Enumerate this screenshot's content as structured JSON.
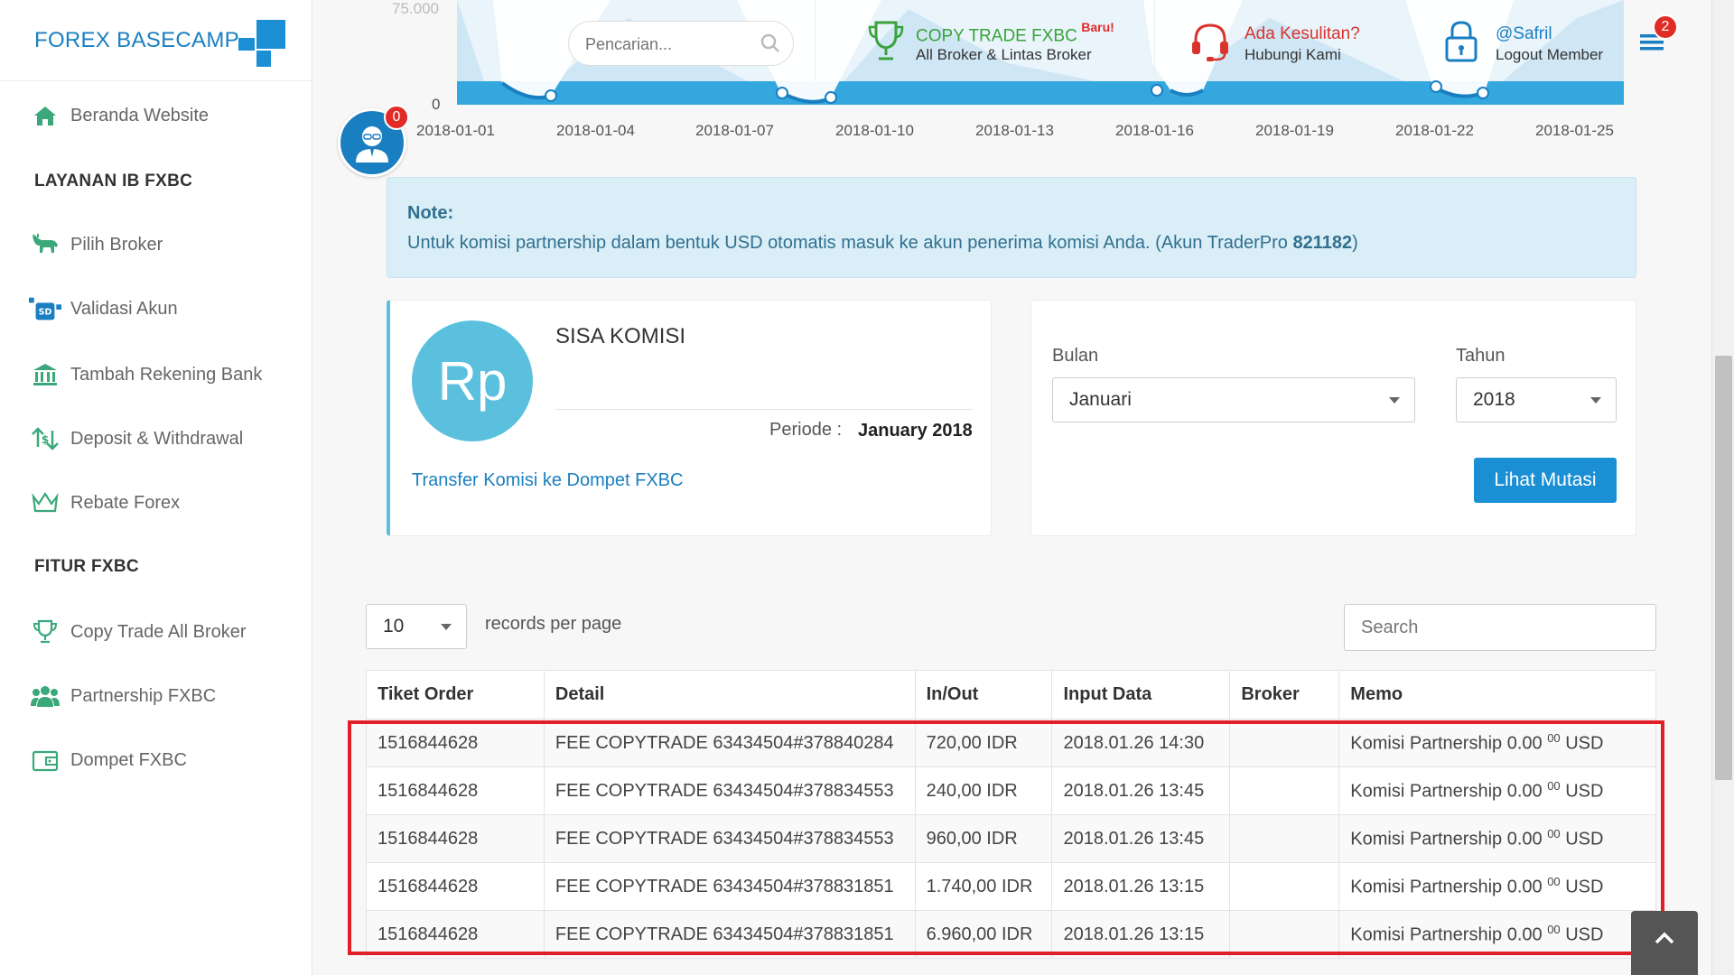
{
  "brand": {
    "name": "FOREX BASECAMP"
  },
  "sidebar": {
    "items": [
      {
        "label": "Beranda Website",
        "icon": "home-icon"
      },
      {
        "label": "Pilih Broker",
        "icon": "bull-icon"
      },
      {
        "label": "Validasi Akun",
        "icon": "sd-card-icon"
      },
      {
        "label": "Tambah Rekening Bank",
        "icon": "bank-icon"
      },
      {
        "label": "Deposit & Withdrawal",
        "icon": "exchange-dollar-icon"
      },
      {
        "label": "Rebate Forex",
        "icon": "crown-icon"
      },
      {
        "label": "Copy Trade All Broker",
        "icon": "trophy-icon"
      },
      {
        "label": "Partnership FXBC",
        "icon": "users-icon"
      },
      {
        "label": "Dompet FXBC",
        "icon": "wallet-icon"
      }
    ],
    "section_layanan": "LAYANAN IB FXBC",
    "section_fitur": "FITUR FXBC"
  },
  "topbar": {
    "search_placeholder": "Pencarian...",
    "copy_trade": {
      "title": "COPY TRADE FXBC",
      "badge": "Baru!",
      "sub": "All Broker & Lintas Broker"
    },
    "help": {
      "title": "Ada Kesulitan?",
      "sub": "Hubungi Kami"
    },
    "user": {
      "title": "@Safril",
      "sub": "Logout Member"
    },
    "menu_badge": "2"
  },
  "chart": {
    "y_tick_top": "75.000",
    "y_tick_zero": "0",
    "x_ticks": [
      "2018-01-01",
      "2018-01-04",
      "2018-01-07",
      "2018-01-10",
      "2018-01-13",
      "2018-01-16",
      "2018-01-19",
      "2018-01-22",
      "2018-01-25"
    ]
  },
  "avatar": {
    "badge": "0"
  },
  "note": {
    "title": "Note:",
    "text": "Untuk komisi partnership dalam bentuk USD otomatis masuk ke akun penerima komisi Anda. (Akun TraderPro ",
    "account": "821182",
    "text_end": ")"
  },
  "komisi": {
    "circle": "Rp",
    "title": "SISA KOMISI",
    "periode_label": "Periode :",
    "periode_value": "January 2018",
    "transfer_link": "Transfer Komisi ke Dompet FXBC"
  },
  "filter": {
    "bulan_label": "Bulan",
    "bulan_value": "Januari",
    "tahun_label": "Tahun",
    "tahun_value": "2018",
    "button": "Lihat Mutasi"
  },
  "table_controls": {
    "length_value": "10",
    "records_label": "records per page",
    "search_placeholder": "Search"
  },
  "table": {
    "headers": [
      "Tiket Order",
      "Detail",
      "In/Out",
      "Input Data",
      "Broker",
      "Memo"
    ],
    "rows": [
      {
        "tiket": "1516844628",
        "detail": "FEE COPYTRADE 63434504#378840284",
        "inout": "720,00 IDR",
        "input": "2018.01.26 14:30",
        "broker": "",
        "memo_pre": "Komisi Partnership 0.00 ",
        "memo_sup": "00",
        "memo_post": " USD"
      },
      {
        "tiket": "1516844628",
        "detail": "FEE COPYTRADE 63434504#378834553",
        "inout": "240,00 IDR",
        "input": "2018.01.26 13:45",
        "broker": "",
        "memo_pre": "Komisi Partnership 0.00 ",
        "memo_sup": "00",
        "memo_post": " USD"
      },
      {
        "tiket": "1516844628",
        "detail": "FEE COPYTRADE 63434504#378834553",
        "inout": "960,00 IDR",
        "input": "2018.01.26 13:45",
        "broker": "",
        "memo_pre": "Komisi Partnership 0.00 ",
        "memo_sup": "00",
        "memo_post": " USD"
      },
      {
        "tiket": "1516844628",
        "detail": "FEE COPYTRADE 63434504#378831851",
        "inout": "1.740,00 IDR",
        "input": "2018.01.26 13:15",
        "broker": "",
        "memo_pre": "Komisi Partnership 0.00 ",
        "memo_sup": "00",
        "memo_post": " USD"
      },
      {
        "tiket": "1516844628",
        "detail": "FEE COPYTRADE 63434504#378831851",
        "inout": "6.960,00 IDR",
        "input": "2018.01.26 13:15",
        "broker": "",
        "memo_pre": "Komisi Partnership 0.00 ",
        "memo_sup": "00",
        "memo_post": " USD"
      }
    ]
  },
  "colors": {
    "brand_blue": "#1a7fc1",
    "accent_cyan": "#5bc0de",
    "copy_green": "#3aa23a",
    "help_red": "#d9332c",
    "highlight_red": "#e01f26"
  }
}
